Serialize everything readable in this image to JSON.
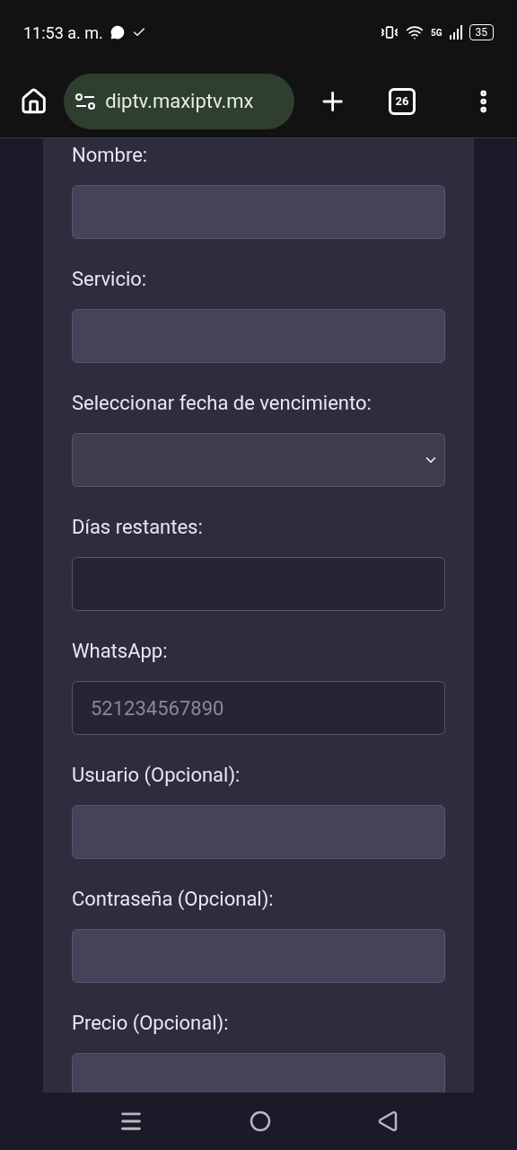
{
  "status_bar": {
    "time": "11:53 a. m.",
    "network": "5G",
    "battery": "35"
  },
  "browser": {
    "url": "diptv.maxiptv.mx",
    "tab_count": "26"
  },
  "form": {
    "fields": [
      {
        "label": "Nombre:",
        "kind": "text",
        "readonly": false
      },
      {
        "label": "Servicio:",
        "kind": "text",
        "readonly": false
      },
      {
        "label": "Seleccionar fecha de vencimiento:",
        "kind": "select",
        "readonly": false
      },
      {
        "label": "Días restantes:",
        "kind": "text",
        "readonly": true
      },
      {
        "label": "WhatsApp:",
        "kind": "text",
        "readonly": true,
        "placeholder": "521234567890"
      },
      {
        "label": "Usuario (Opcional):",
        "kind": "text",
        "readonly": false
      },
      {
        "label": "Contraseña (Opcional):",
        "kind": "text",
        "readonly": false
      },
      {
        "label": "Precio (Opcional):",
        "kind": "text",
        "readonly": false
      }
    ]
  }
}
